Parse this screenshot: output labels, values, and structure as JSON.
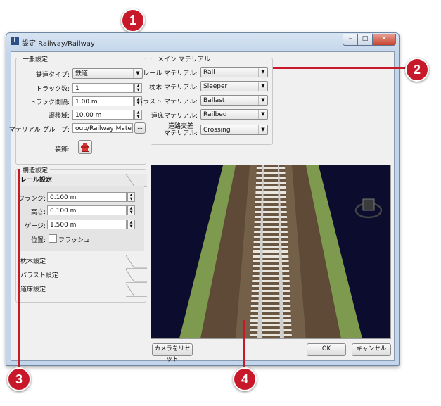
{
  "window": {
    "title": "設定 Railway/Railway",
    "minimize": "–",
    "maximize": "□",
    "close": "✕"
  },
  "general": {
    "legend": "一般設定",
    "railway_type_label": "鉄道タイプ:",
    "railway_type_value": "鉄道",
    "track_count_label": "トラック数:",
    "track_count_value": "1",
    "track_spacing_label": "トラック間隔:",
    "track_spacing_value": "1.00 m",
    "transition_label": "遷移域:",
    "transition_value": "10.00 m",
    "material_group_label": "マテリアル グループ:",
    "material_group_value": "oup/Railway Materials",
    "browse_label": "...",
    "decoration_label": "装飾:"
  },
  "main_material": {
    "legend": "メイン マテリアル",
    "rows": [
      {
        "label": "レール マテリアル:",
        "value": "Rail"
      },
      {
        "label": "枕木 マテリアル:",
        "value": "Sleeper"
      },
      {
        "label": "バラスト マテリアル:",
        "value": "Ballast"
      },
      {
        "label": "道床マテリアル:",
        "value": "Railbed"
      },
      {
        "label": "道路交差\nマテリアル:",
        "value": "Crossing"
      }
    ]
  },
  "structure": {
    "legend": "構造設定",
    "rail_tab": "レール設定",
    "flange_label": "フランジ:",
    "flange_value": "0.100 m",
    "height_label": "高さ:",
    "height_value": "0.100 m",
    "gauge_label": "ゲージ:",
    "gauge_value": "1.500 m",
    "position_label": "位置:",
    "flush_label": "フラッシュ",
    "sleeper_tab": "枕木設定",
    "ballast_tab": "バラスト設定",
    "railbed_tab": "道床設定"
  },
  "buttons": {
    "reset_camera": "カメラをリセット",
    "ok": "OK",
    "cancel": "キャンセル"
  },
  "callouts": [
    "1",
    "2",
    "3",
    "4"
  ],
  "colors": {
    "callout": "#c8192a",
    "viewport_sky": "#0c0c2e",
    "grass": "#7d9a4e",
    "ballast": "#5e4a36"
  },
  "icons": {
    "app": "app-icon",
    "decoration": "fire-hydrant-icon",
    "view_cube": "view-cube-icon"
  }
}
